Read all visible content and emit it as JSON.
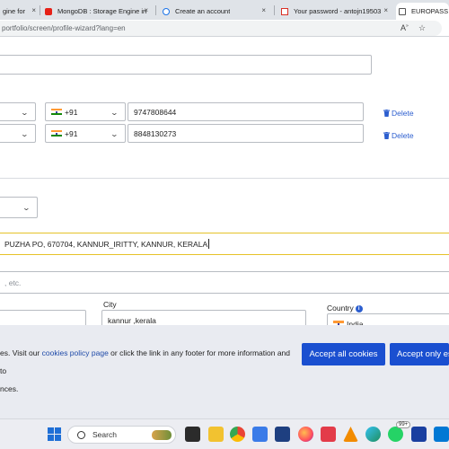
{
  "browser": {
    "tabs": [
      {
        "title": "gine for",
        "icon": "google-icon",
        "active": false
      },
      {
        "title": "MongoDB : Storage Engine in",
        "icon": "youtube-icon",
        "active": false
      },
      {
        "title": "Create an account",
        "icon": "loading-icon",
        "active": false
      },
      {
        "title": "Your password - antojn19503",
        "icon": "gmail-icon",
        "active": false
      },
      {
        "title": "EUROPASS",
        "icon": "page-icon",
        "active": true
      }
    ],
    "tab_close_glyph": "×",
    "url": "portfolio/screen/profile-wizard?lang=en"
  },
  "form": {
    "phones": [
      {
        "country_code": "+91",
        "number": "9747808644",
        "delete_label": "Delete"
      },
      {
        "country_code": "+91",
        "number": "8848130273",
        "delete_label": "Delete"
      }
    ],
    "address_line": "PUZHA PO, 670704, KANNUR_IRITTY, KANNUR, KERALA",
    "address_hint": ", etc.",
    "city_label": "City",
    "city_value": "kannur ,kerala",
    "country_label": "Country",
    "country_value": "India"
  },
  "cookie_banner": {
    "text_pre": "es. Visit our ",
    "link": "cookies policy page",
    "text_post": " or click the link in any footer for more information and to",
    "line2": "nces.",
    "accept_all": "Accept all cookies",
    "accept_essential": "Accept only es"
  },
  "taskbar": {
    "search_label": "Search",
    "badge": "99+"
  },
  "colors": {
    "accent": "#1a4fd0",
    "link": "#2c5ecf",
    "focus_border": "#e6c229"
  }
}
